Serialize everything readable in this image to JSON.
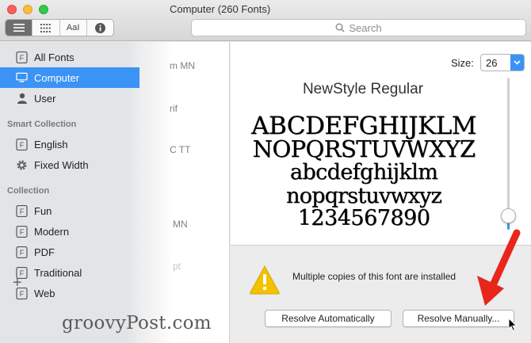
{
  "window": {
    "title": "Computer (260 Fonts)"
  },
  "toolbar": {
    "view_buttons": [
      {
        "icon": "list-view-icon"
      },
      {
        "icon": "grid-view-icon"
      },
      {
        "icon": "sample-view-icon",
        "label": "AaI"
      },
      {
        "icon": "info-icon"
      }
    ],
    "search_placeholder": "Search"
  },
  "sidebar": {
    "library_items": [
      {
        "label": "All Fonts",
        "icon": "font-library-icon"
      },
      {
        "label": "Computer",
        "icon": "computer-icon",
        "selected": true
      },
      {
        "label": "User",
        "icon": "user-icon"
      }
    ],
    "smart_collection_title": "Smart Collection",
    "smart_items": [
      {
        "label": "English",
        "icon": "collection-icon"
      },
      {
        "label": "Fixed Width",
        "icon": "gear-icon"
      }
    ],
    "collection_title": "Collection",
    "collection_items": [
      {
        "label": "Fun"
      },
      {
        "label": "Modern"
      },
      {
        "label": "PDF"
      },
      {
        "label": "Traditional"
      },
      {
        "label": "Web"
      }
    ],
    "add_label": "+"
  },
  "font_list": {
    "fragments": [
      "m MN",
      "rif",
      "C TT",
      "MN",
      "pt"
    ]
  },
  "preview": {
    "size_label": "Size:",
    "size_value": "26",
    "font_name": "NewStyle Regular",
    "sample_lines": [
      "ABCDEFGHIJKLM",
      "NOPQRSTUVWXYZ",
      "abcdefghijklm",
      "nopqrstuvwxyz",
      "1234567890"
    ],
    "slider_level": 0.93
  },
  "warning": {
    "message": "Multiple copies of this font are installed",
    "resolve_auto": "Resolve Automatically",
    "resolve_manual": "Resolve Manually..."
  },
  "watermark": "groovyPost.com",
  "colors": {
    "accent": "#3b93f5",
    "arrow": "#e8261c",
    "warning": "#f2c200"
  }
}
